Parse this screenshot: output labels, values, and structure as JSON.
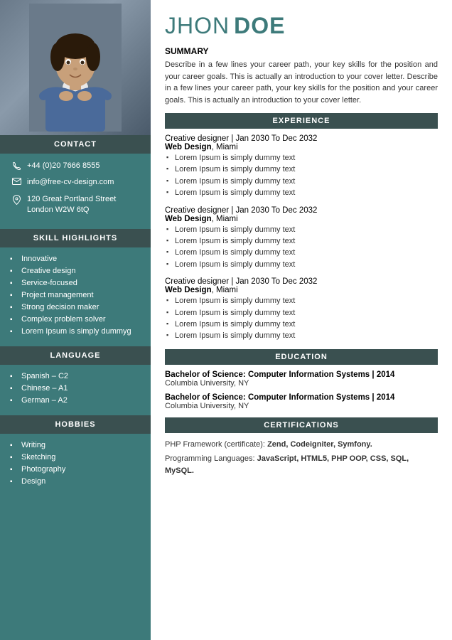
{
  "sidebar": {
    "contact_header": "CONTACT",
    "phone": "+44 (0)20 7666 8555",
    "email": "info@free-cv-design.com",
    "address_line1": "120 Great Portland Street",
    "address_line2": "London W2W 6tQ",
    "skills_header": "SKILL HIGHLIGHTS",
    "skills": [
      "Innovative",
      "Creative design",
      "Service-focused",
      "Project management",
      "Strong decision maker",
      "Complex problem solver",
      "Lorem Ipsum is simply dummyg"
    ],
    "language_header": "LANGUAGE",
    "languages": [
      "Spanish – C2",
      "Chinese – A1",
      "German – A2"
    ],
    "hobbies_header": "HOBBIES",
    "hobbies": [
      "Writing",
      "Sketching",
      "Photography",
      "Design"
    ]
  },
  "main": {
    "first_name": "JHON",
    "last_name": "DOE",
    "summary_header": "SUMMARY",
    "summary_text": "Describe in a few lines your career path, your key skills for the position and your career goals. This is actually an introduction to your cover letter. Describe in a few lines your career path, your key skills for the position and your career goals. This is actually an introduction to your cover letter.",
    "experience_header": "EXPERIENCE",
    "experiences": [
      {
        "title": "Creative designer",
        "period": "Jan 2030 To Dec 2032",
        "company": "Web Design",
        "location": "Miami",
        "bullets": [
          "Lorem Ipsum is simply dummy text",
          "Lorem Ipsum is simply dummy text",
          "Lorem Ipsum is simply dummy text",
          "Lorem Ipsum is simply dummy text"
        ]
      },
      {
        "title": "Creative designer",
        "period": "Jan 2030 To Dec 2032",
        "company": "Web Design",
        "location": "Miami",
        "bullets": [
          "Lorem Ipsum is simply dummy text",
          "Lorem Ipsum is simply dummy text",
          "Lorem Ipsum is simply dummy text",
          "Lorem Ipsum is simply dummy text"
        ]
      },
      {
        "title": "Creative designer",
        "period": "Jan 2030 To Dec 2032",
        "company": "Web Design",
        "location": "Miami",
        "bullets": [
          "Lorem Ipsum is simply dummy text",
          "Lorem Ipsum is simply dummy text",
          "Lorem Ipsum is simply dummy text",
          "Lorem Ipsum is simply dummy text"
        ]
      }
    ],
    "education_header": "EDUCATION",
    "educations": [
      {
        "degree": "Bachelor of Science: Computer Information Systems",
        "year": "2014",
        "institution": "Columbia University, NY"
      },
      {
        "degree": "Bachelor of Science: Computer Information Systems",
        "year": "2014",
        "institution": "Columbia University, NY"
      }
    ],
    "certifications_header": "CERTIFICATIONS",
    "cert1_prefix": "PHP Framework (certificate): ",
    "cert1_bold": "Zend, Codeigniter, Symfony.",
    "cert2_prefix": "Programming Languages: ",
    "cert2_bold": "JavaScript, HTML5, PHP OOP, CSS, SQL, MySQL."
  }
}
